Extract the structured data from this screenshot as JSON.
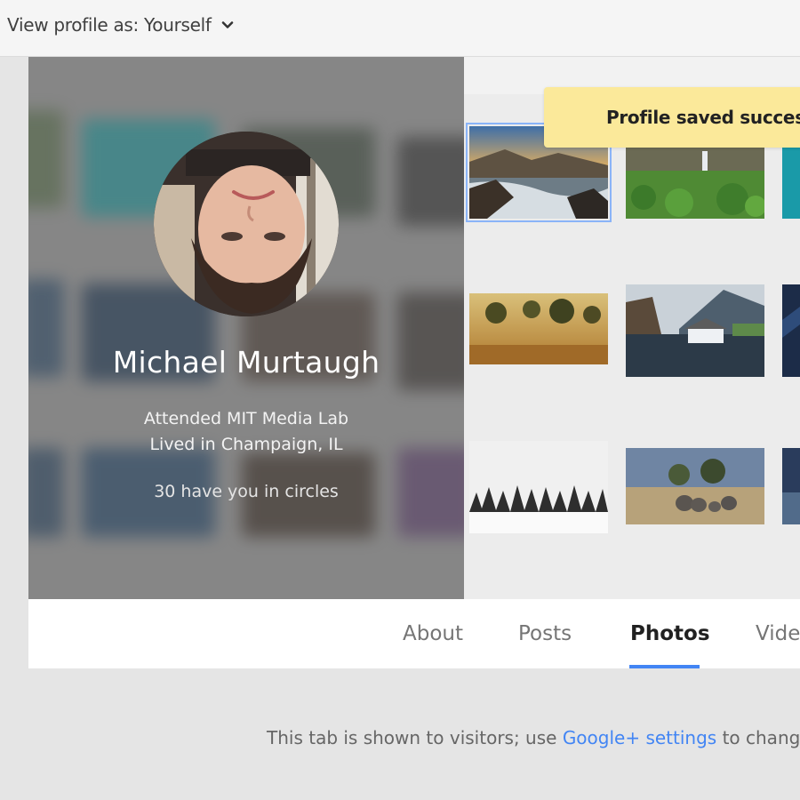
{
  "header": {
    "view_profile_label": "View profile as: Yourself",
    "dropdown_icon": "chevron-down-icon"
  },
  "profile": {
    "name": "Michael Murtaugh",
    "education": "Attended MIT Media Lab",
    "location": "Lived in Champaign, IL",
    "circles": "30 have you in circles"
  },
  "toast": {
    "message": "Profile saved success"
  },
  "tabs": [
    {
      "label": "About"
    },
    {
      "label": "Posts"
    },
    {
      "label": "Photos",
      "active": true
    },
    {
      "label": "Vide"
    }
  ],
  "footer": {
    "text_before": "This tab is shown to visitors; use ",
    "link": "Google+ settings",
    "text_after": " to chang"
  },
  "colors": {
    "accent": "#4285f4",
    "toast_bg": "#fbe99a",
    "cover_bg": "#8e8e8e"
  }
}
